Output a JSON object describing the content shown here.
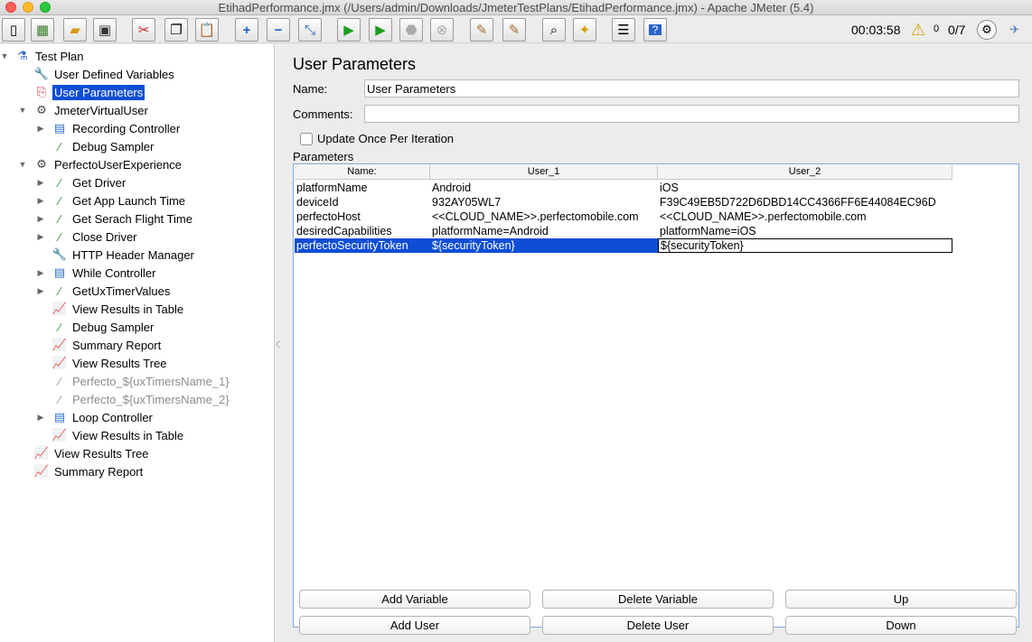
{
  "window": {
    "title": "EtihadPerformance.jmx (/Users/admin/Downloads/JmeterTestPlans/EtihadPerformance.jmx) - Apache JMeter (5.4)"
  },
  "toolbar": {
    "buttons": [
      "new-icon",
      "templates-icon",
      "open-icon",
      "save-icon",
      "cut-icon",
      "copy-icon",
      "paste-icon",
      "expand-icon",
      "collapse-icon",
      "toggle-icon",
      "start-icon",
      "start-no-pauses-icon",
      "stop-icon",
      "shutdown-icon",
      "clear-icon",
      "clear-all-icon",
      "search-icon",
      "reset-search-icon",
      "function-helper-icon",
      "help-icon"
    ],
    "elapsed": "00:03:58",
    "warnings": "0",
    "threads": "0/7"
  },
  "tree": {
    "items": [
      {
        "label": "Test Plan",
        "icon": "test-plan-icon"
      },
      {
        "label": "User Defined Variables",
        "icon": "wrench-icon"
      },
      {
        "label": "User Parameters",
        "icon": "user-params-icon"
      },
      {
        "label": "JmeterVirtualUser",
        "icon": "gear-icon"
      },
      {
        "label": "Recording Controller",
        "icon": "controller-icon"
      },
      {
        "label": "Debug Sampler",
        "icon": "pipette-icon"
      },
      {
        "label": "PerfectoUserExperience",
        "icon": "gear-icon"
      },
      {
        "label": "Get Driver",
        "icon": "pipette-icon"
      },
      {
        "label": "Get App Launch Time",
        "icon": "pipette-icon"
      },
      {
        "label": "Get Serach Flight Time",
        "icon": "pipette-icon"
      },
      {
        "label": "Close Driver",
        "icon": "pipette-icon"
      },
      {
        "label": "HTTP Header Manager",
        "icon": "wrench-icon"
      },
      {
        "label": "While Controller",
        "icon": "controller-icon"
      },
      {
        "label": "GetUxTimerValues",
        "icon": "pipette-icon"
      },
      {
        "label": "View Results in Table",
        "icon": "graph-icon"
      },
      {
        "label": "Debug Sampler",
        "icon": "pipette-icon"
      },
      {
        "label": "Summary Report",
        "icon": "graph-icon"
      },
      {
        "label": "View Results Tree",
        "icon": "graph-icon"
      },
      {
        "label": "Perfecto_${uxTimersName_1}",
        "icon": "pipette-icon"
      },
      {
        "label": "Perfecto_${uxTimersName_2}",
        "icon": "pipette-icon"
      },
      {
        "label": "Loop Controller",
        "icon": "controller-icon"
      },
      {
        "label": "View Results in Table",
        "icon": "graph-icon"
      },
      {
        "label": "View Results Tree",
        "icon": "graph-icon"
      },
      {
        "label": "Summary Report",
        "icon": "graph-icon"
      }
    ]
  },
  "panel": {
    "title": "User Parameters",
    "name_label": "Name:",
    "name_value": "User Parameters",
    "comments_label": "Comments:",
    "comments_value": "",
    "update_once_label": "Update Once Per Iteration",
    "update_once_checked": false,
    "parameters_label": "Parameters"
  },
  "table": {
    "headers": [
      "Name:",
      "User_1",
      "User_2"
    ],
    "rows": [
      [
        "platformName",
        "Android",
        "iOS"
      ],
      [
        "deviceId",
        "932AY05WL7",
        "F39C49EB5D722D6DBD14CC4366FF6E44084EC96D"
      ],
      [
        "perfectoHost",
        "<<CLOUD_NAME>>.perfectomobile.com",
        "<<CLOUD_NAME>>.perfectomobile.com"
      ],
      [
        "desiredCapabilities",
        "platformName=Android",
        "platformName=iOS"
      ],
      [
        "perfectoSecurityToken",
        "${securityToken}",
        "${securityToken}"
      ]
    ],
    "selected_row": 4
  },
  "buttons": {
    "add_variable": "Add Variable",
    "delete_variable": "Delete Variable",
    "up": "Up",
    "add_user": "Add User",
    "delete_user": "Delete User",
    "down": "Down"
  },
  "colors": {
    "selection": "#0e4ed6",
    "close": "#fe5f57",
    "minimize": "#febc2e",
    "maximize": "#28c840"
  }
}
